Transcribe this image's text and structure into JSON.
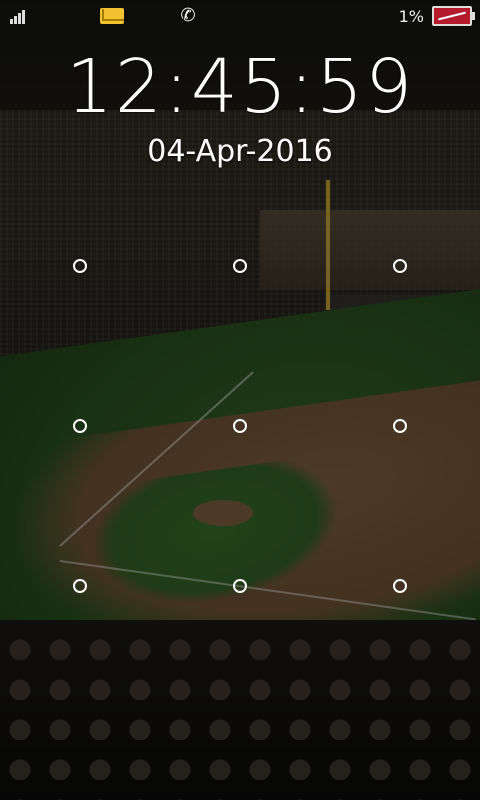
{
  "status_bar": {
    "signal_icon": "signal-bars-icon",
    "notifications": [
      "mail-icon",
      "missed-call-icon"
    ],
    "battery_percent": "1%",
    "battery_icon": "battery-empty-icon",
    "battery_color": "#b51b2c"
  },
  "clock": {
    "time": "12:45:59",
    "date": "04-Apr-2016"
  },
  "pattern_lock": {
    "rows": 3,
    "cols": 3,
    "dot_color": "#ffffff"
  },
  "wallpaper": {
    "description_icon": "baseball-stadium-wallpaper"
  }
}
